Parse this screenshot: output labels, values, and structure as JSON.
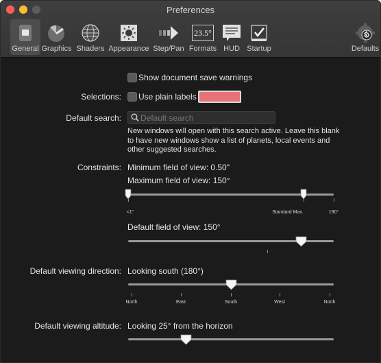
{
  "window": {
    "title": "Preferences"
  },
  "toolbar": {
    "items": [
      {
        "label": "General",
        "icon": "general-switch-icon",
        "selected": true
      },
      {
        "label": "Graphics",
        "icon": "graphics-icon"
      },
      {
        "label": "Shaders",
        "icon": "shaders-globe-icon"
      },
      {
        "label": "Appearance",
        "icon": "appearance-sun-icon"
      },
      {
        "label": "Step/Pan",
        "icon": "step-pan-arrow-icon"
      },
      {
        "label": "Formats",
        "icon": "formats-icon",
        "icon_text": "23.5°"
      },
      {
        "label": "HUD",
        "icon": "hud-icon"
      },
      {
        "label": "Startup",
        "icon": "startup-checkmark-icon"
      },
      {
        "label": "Defaults",
        "icon": "defaults-restore-icon"
      }
    ]
  },
  "general": {
    "save_warnings_label": "Show document save warnings",
    "selections_label": "Selections:",
    "plain_labels_label": "Use plain labels",
    "selection_color": "#e77379",
    "default_search_label": "Default search:",
    "search_placeholder": "Default search",
    "search_value": "",
    "search_help": "New windows will open with this search active. Leave this blank to have new windows show a list of planets, local events and other suggested searches.",
    "constraints_label": "Constraints:",
    "min_fov_text": "Minimum field of view: 0.50\"",
    "max_fov_text": "Maximum field of view: 150°",
    "max_fov_slider": {
      "tick_labels": [
        "<1°",
        "Standard Max.",
        "190°"
      ],
      "min_value_pct": 0,
      "max_value_pct": 85
    },
    "default_fov_text": "Default field of view: 150°",
    "default_fov_slider": {
      "value_pct": 84
    },
    "viewing_direction_label": "Default viewing direction:",
    "viewing_direction_text": "Looking south (180°)",
    "direction_slider": {
      "tick_labels": [
        "North",
        "East",
        "South",
        "West",
        "North"
      ],
      "value_pct": 50
    },
    "viewing_altitude_label": "Default viewing altitude:",
    "viewing_altitude_text": "Looking 25° from the horizon",
    "altitude_slider": {
      "value_pct": 28
    }
  }
}
